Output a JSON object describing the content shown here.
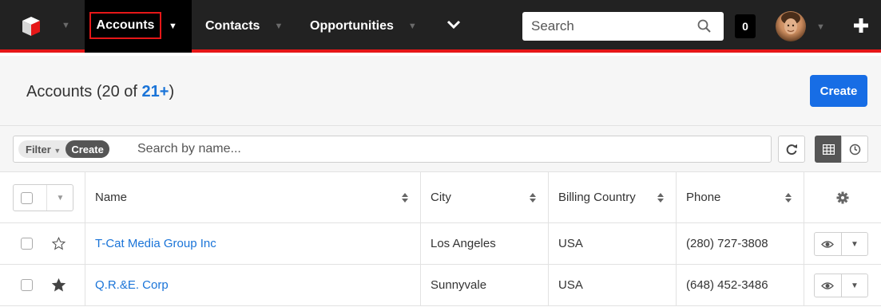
{
  "nav": {
    "items": [
      {
        "label": "Accounts"
      },
      {
        "label": "Contacts"
      },
      {
        "label": "Opportunities"
      }
    ],
    "search_placeholder": "Search",
    "notification_count": "0",
    "icons": {
      "logo": "sugar-cube-icon",
      "search": "search-icon",
      "more": "chevron-down-icon",
      "add": "plus-icon"
    }
  },
  "header": {
    "title_prefix": "Accounts (20 of ",
    "count_link": "21+",
    "title_suffix": ")",
    "create_label": "Create"
  },
  "filter": {
    "filter_label": "Filter",
    "create_label": "Create",
    "search_placeholder": "Search by name..."
  },
  "table": {
    "columns": [
      "Name",
      "City",
      "Billing Country",
      "Phone"
    ],
    "rows": [
      {
        "name": "T-Cat Media Group Inc",
        "city": "Los Angeles",
        "country": "USA",
        "phone": "(280) 727-3808",
        "favorite": false
      },
      {
        "name": "Q.R.&E. Corp",
        "city": "Sunnyvale",
        "country": "USA",
        "phone": "(648) 452-3486",
        "favorite": true
      }
    ]
  },
  "colors": {
    "nav_bg": "#222222",
    "accent_red": "#e61718",
    "primary_blue": "#176de5",
    "link_blue": "#1a74d8"
  }
}
